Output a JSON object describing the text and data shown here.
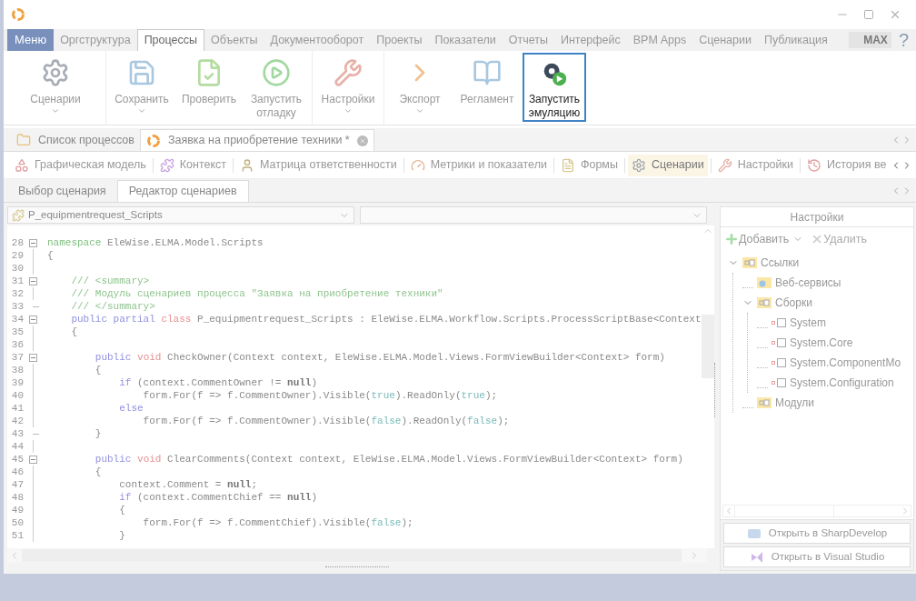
{
  "menu_tabs": [
    {
      "label": "Меню",
      "kind": "menu",
      "selected": false
    },
    {
      "label": "Оргструктура",
      "kind": "tab",
      "selected": false
    },
    {
      "label": "Процессы",
      "kind": "tab",
      "selected": true
    },
    {
      "label": "Объекты",
      "kind": "tab",
      "selected": false
    },
    {
      "label": "Документооборот",
      "kind": "tab",
      "selected": false
    },
    {
      "label": "Проекты",
      "kind": "tab",
      "selected": false
    },
    {
      "label": "Показатели",
      "kind": "tab",
      "selected": false
    },
    {
      "label": "Отчеты",
      "kind": "tab",
      "selected": false
    },
    {
      "label": "Интерфейс",
      "kind": "tab",
      "selected": false
    },
    {
      "label": "BPM Apps",
      "kind": "tab",
      "selected": false
    },
    {
      "label": "Сценарии",
      "kind": "tab",
      "selected": false
    },
    {
      "label": "Публикация",
      "kind": "tab",
      "selected": false
    }
  ],
  "max_badge": "MAX",
  "help": "?",
  "ribbon_groups": [
    [
      {
        "label": "Сценарии",
        "menu": true,
        "active": false
      }
    ],
    [
      {
        "label": "Сохранить",
        "menu": true,
        "active": false
      },
      {
        "label": "Проверить",
        "menu": false,
        "active": false
      },
      {
        "label": "Запустить отладку",
        "menu": false,
        "active": false
      }
    ],
    [
      {
        "label": "Настройки",
        "menu": true,
        "active": false
      }
    ],
    [
      {
        "label": "Экспорт",
        "menu": true,
        "active": false
      },
      {
        "label": "Регламент",
        "menu": false,
        "active": false
      },
      {
        "label": "Запустить эмуляцию",
        "menu": false,
        "active": true
      }
    ]
  ],
  "doc_tabs": [
    {
      "label": "Список процессов",
      "selected": false,
      "closable": false
    },
    {
      "label": "Заявка на приобретение техники *",
      "selected": true,
      "closable": true
    }
  ],
  "view_tabs": [
    {
      "label": "Графическая модель",
      "selected": false
    },
    {
      "label": "Контекст",
      "selected": false
    },
    {
      "label": "Матрица ответственности",
      "selected": false
    },
    {
      "label": "Метрики и показатели",
      "selected": false
    },
    {
      "label": "Формы",
      "selected": false
    },
    {
      "label": "Сценарии",
      "selected": true
    },
    {
      "label": "Настройки",
      "selected": false
    },
    {
      "label": "История ве",
      "selected": false
    }
  ],
  "editor_tabs": [
    {
      "label": "Выбор сценария",
      "selected": false
    },
    {
      "label": "Редактор сценариев",
      "selected": true
    }
  ],
  "class_select": {
    "value": "P_equipmentrequest_Scripts"
  },
  "code": [
    {
      "n": "28",
      "kind": "fold_start",
      "parts": [
        {
          "kind": "namespace",
          "text": "namespace"
        },
        {
          "kind": "plain",
          "text": " EleWise.ELMA.Model.Scripts"
        }
      ]
    },
    {
      "n": "29",
      "kind": "body",
      "parts": [
        {
          "kind": "plain",
          "text": "{"
        }
      ]
    },
    {
      "n": "30",
      "kind": "body"
    },
    {
      "n": "31",
      "kind": "fold_start",
      "parts": [
        {
          "kind": "comment",
          "text": "    /// <summary>"
        }
      ]
    },
    {
      "n": "32",
      "kind": "body",
      "parts": [
        {
          "kind": "comment",
          "text": "    /// Модуль сценариев процесса \"Заявка на приобретение техники\""
        }
      ]
    },
    {
      "n": "33",
      "kind": "fold_end",
      "parts": [
        {
          "kind": "comment",
          "text": "    /// </summary>"
        }
      ]
    },
    {
      "n": "34",
      "kind": "fold_start",
      "parts": [
        {
          "kind": "keyword",
          "text": "    public partial "
        },
        {
          "kind": "type_keyword",
          "text": "class"
        },
        {
          "kind": "plain",
          "text": " P_equipmentrequest_Scripts : EleWise.ELMA.Workflow.Scripts.ProcessScriptBase<Context"
        }
      ]
    },
    {
      "n": "35",
      "kind": "body",
      "parts": [
        {
          "kind": "plain",
          "text": "    {"
        }
      ]
    },
    {
      "n": "36",
      "kind": "body"
    },
    {
      "n": "37",
      "kind": "fold_start",
      "parts": [
        {
          "kind": "keyword",
          "text": "        public "
        },
        {
          "kind": "type_keyword",
          "text": "void"
        },
        {
          "kind": "plain",
          "text": " CheckOwner(Context context, EleWise.ELMA.Model.Views.FormViewBuilder<Context> form)"
        }
      ]
    },
    {
      "n": "38",
      "kind": "body",
      "parts": [
        {
          "kind": "plain",
          "text": "        {"
        }
      ]
    },
    {
      "n": "39",
      "kind": "body",
      "parts": [
        {
          "kind": "keyword",
          "text": "            if"
        },
        {
          "kind": "plain",
          "text": " (context.CommentOwner != "
        },
        {
          "kind": "null",
          "text": "null"
        },
        {
          "kind": "plain",
          "text": ")"
        }
      ]
    },
    {
      "n": "40",
      "kind": "body",
      "parts": [
        {
          "kind": "plain",
          "text": "                form.For(f => f.CommentOwner).Visible("
        },
        {
          "kind": "literal",
          "text": "true"
        },
        {
          "kind": "plain",
          "text": ").ReadOnly("
        },
        {
          "kind": "literal",
          "text": "true"
        },
        {
          "kind": "plain",
          "text": ");"
        }
      ]
    },
    {
      "n": "41",
      "kind": "body",
      "parts": [
        {
          "kind": "keyword",
          "text": "            else"
        }
      ]
    },
    {
      "n": "42",
      "kind": "body",
      "parts": [
        {
          "kind": "plain",
          "text": "                form.For(f => f.CommentOwner).Visible("
        },
        {
          "kind": "literal",
          "text": "false"
        },
        {
          "kind": "plain",
          "text": ").ReadOnly("
        },
        {
          "kind": "literal",
          "text": "false"
        },
        {
          "kind": "plain",
          "text": ");"
        }
      ]
    },
    {
      "n": "43",
      "kind": "fold_end",
      "parts": [
        {
          "kind": "plain",
          "text": "        }"
        }
      ]
    },
    {
      "n": "44",
      "kind": "body"
    },
    {
      "n": "45",
      "kind": "fold_start",
      "parts": [
        {
          "kind": "keyword",
          "text": "        public "
        },
        {
          "kind": "type_keyword",
          "text": "void"
        },
        {
          "kind": "plain",
          "text": " ClearComments(Context context, EleWise.ELMA.Model.Views.FormViewBuilder<Context> form)"
        }
      ]
    },
    {
      "n": "46",
      "kind": "body",
      "parts": [
        {
          "kind": "plain",
          "text": "        {"
        }
      ]
    },
    {
      "n": "47",
      "kind": "body",
      "parts": [
        {
          "kind": "plain",
          "text": "            context.Comment = "
        },
        {
          "kind": "null",
          "text": "null"
        },
        {
          "kind": "plain",
          "text": ";"
        }
      ]
    },
    {
      "n": "48",
      "kind": "body",
      "parts": [
        {
          "kind": "keyword",
          "text": "            if"
        },
        {
          "kind": "plain",
          "text": " (context.CommentChief == "
        },
        {
          "kind": "null",
          "text": "null"
        },
        {
          "kind": "plain",
          "text": ")"
        }
      ]
    },
    {
      "n": "49",
      "kind": "body",
      "parts": [
        {
          "kind": "plain",
          "text": "            {"
        }
      ]
    },
    {
      "n": "50",
      "kind": "body",
      "parts": [
        {
          "kind": "plain",
          "text": "                form.For(f => f.CommentChief).Visible("
        },
        {
          "kind": "literal",
          "text": "false"
        },
        {
          "kind": "plain",
          "text": ");"
        }
      ]
    },
    {
      "n": "51",
      "kind": "body",
      "parts": [
        {
          "kind": "plain",
          "text": "            }"
        }
      ]
    }
  ],
  "settings_panel": {
    "title": "Настройки",
    "add": "Добавить",
    "delete": "Удалить",
    "tree": [
      {
        "label": "Ссылки",
        "kind": "folder",
        "expanded": true,
        "children": [
          {
            "label": "Веб-сервисы",
            "kind": "web",
            "expanded": false
          },
          {
            "label": "Сборки",
            "kind": "folder",
            "expanded": true,
            "children": [
              {
                "label": "System",
                "kind": "assembly",
                "expanded": false
              },
              {
                "label": "System.Core",
                "kind": "assembly",
                "expanded": false
              },
              {
                "label": "System.ComponentMo",
                "kind": "assembly",
                "expanded": false
              },
              {
                "label": "System.Configuration",
                "kind": "assembly",
                "expanded": false
              }
            ]
          },
          {
            "label": "Модули",
            "kind": "folder",
            "expanded": false
          }
        ]
      }
    ],
    "buttons": [
      "Открыть в SharpDevelop",
      "Открыть в Visual Studio"
    ]
  }
}
